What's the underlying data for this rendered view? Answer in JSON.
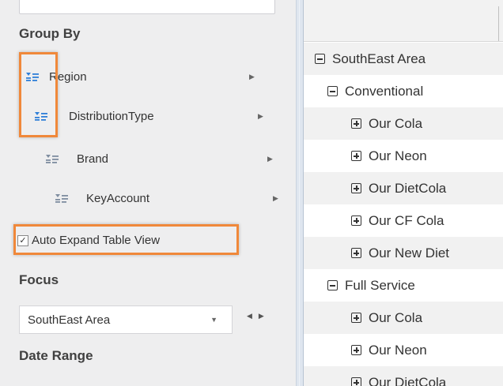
{
  "left_panel": {
    "group_by": {
      "title": "Group By",
      "items": [
        {
          "label": "Region"
        },
        {
          "label": "DistributionType"
        },
        {
          "label": "Brand"
        },
        {
          "label": "KeyAccount"
        }
      ]
    },
    "auto_expand": {
      "label": "Auto Expand Table View",
      "checked": true
    },
    "focus": {
      "title": "Focus",
      "selected": "SouthEast Area"
    },
    "date_range": {
      "title": "Date Range"
    }
  },
  "tree": {
    "rows": [
      {
        "label": "SouthEast Area",
        "state": "collapse"
      },
      {
        "label": "Conventional",
        "state": "collapse"
      },
      {
        "label": "Our Cola",
        "state": "expand"
      },
      {
        "label": "Our Neon",
        "state": "expand"
      },
      {
        "label": "Our DietCola",
        "state": "expand"
      },
      {
        "label": "Our CF Cola",
        "state": "expand"
      },
      {
        "label": "Our New Diet",
        "state": "expand"
      },
      {
        "label": "Full Service",
        "state": "collapse"
      },
      {
        "label": "Our Cola",
        "state": "expand"
      },
      {
        "label": "Our Neon",
        "state": "expand"
      },
      {
        "label": "Our DietCola",
        "state": "expand"
      }
    ]
  },
  "colors": {
    "highlight": "#f0883a",
    "icon_blue": "#2f7fd8",
    "icon_gray": "#7f8da0",
    "panel_bg": "#eeeeef"
  }
}
